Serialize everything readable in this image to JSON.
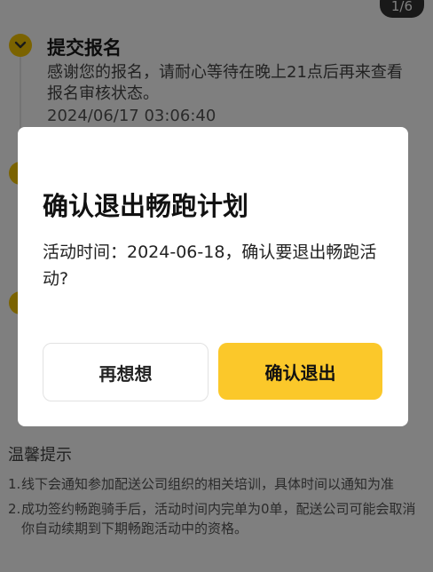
{
  "header": {
    "page_counter": "1/6"
  },
  "timeline": {
    "step1": {
      "title": "提交报名",
      "description": "感谢您的报名，请耐心等待在晚上21点后再来查看报名审核状态。",
      "time": "2024/06/17 03:06:40"
    }
  },
  "tips": {
    "title": "温馨提示",
    "items": [
      {
        "num": "1.",
        "text": "线下会通知参加配送公司组织的相关培训，具体时间以通知为准"
      },
      {
        "num": "2.",
        "text": "成功签约畅跑骑手后，活动时间内完单为0单，配送公司可能会取消你自动续期到下期畅跑活动中的资格。"
      }
    ]
  },
  "modal": {
    "title": "确认退出畅跑计划",
    "body": "活动时间：2024-06-18，确认要退出畅跑活动?",
    "cancel_label": "再想想",
    "confirm_label": "确认退出"
  },
  "colors": {
    "accent": "#fbc82a",
    "overlay": "rgba(0,0,0,0.5)"
  },
  "icons": {
    "step_dot": "chevron-down-icon"
  }
}
